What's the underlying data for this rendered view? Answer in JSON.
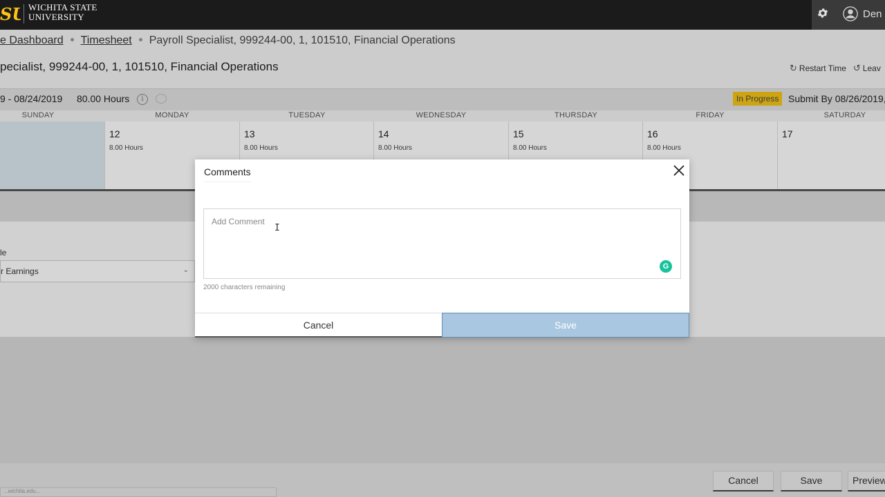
{
  "header": {
    "logo_mark": "SU",
    "university_line1": "WICHITA STATE",
    "university_line2": "UNIVERSITY",
    "user_name": "Den",
    "icons": [
      "gear-icon",
      "user-icon"
    ]
  },
  "breadcrumb": {
    "items": [
      "e Dashboard",
      "Timesheet",
      "Payroll Specialist, 999244-00, 1, 101510, Financial Operations"
    ]
  },
  "page": {
    "title": "pecialist, 999244-00, 1, 101510, Financial Operations",
    "restart_time": "Restart Time",
    "leave": "Leav"
  },
  "period": {
    "range": "9 - 08/24/2019",
    "hours": "80.00 Hours",
    "status": "In Progress",
    "submit_by": "Submit By 08/26/2019,",
    "status_color": "#f5c518"
  },
  "calendar": {
    "days": [
      "SUNDAY",
      "MONDAY",
      "TUESDAY",
      "WEDNESDAY",
      "THURSDAY",
      "FRIDAY",
      "SATURDAY"
    ],
    "dates": [
      {
        "num": "",
        "hours": ""
      },
      {
        "num": "12",
        "hours": "8.00 Hours"
      },
      {
        "num": "13",
        "hours": "8.00 Hours"
      },
      {
        "num": "14",
        "hours": "8.00 Hours"
      },
      {
        "num": "15",
        "hours": "8.00 Hours"
      },
      {
        "num": "16",
        "hours": "8.00 Hours"
      },
      {
        "num": "17",
        "hours": ""
      }
    ]
  },
  "form": {
    "earn_label": "le",
    "earn_value": "r Earnings"
  },
  "footer": {
    "cancel": "Cancel",
    "save": "Save",
    "preview": "Preview"
  },
  "modal": {
    "title": "Comments",
    "placeholder": "Add Comment",
    "remaining": "2000 characters remaining",
    "cancel": "Cancel",
    "save": "Save",
    "grammarly": "G",
    "save_color": "#a9c7e0"
  },
  "status_bar": {
    "text": "...wichita.edu..."
  }
}
